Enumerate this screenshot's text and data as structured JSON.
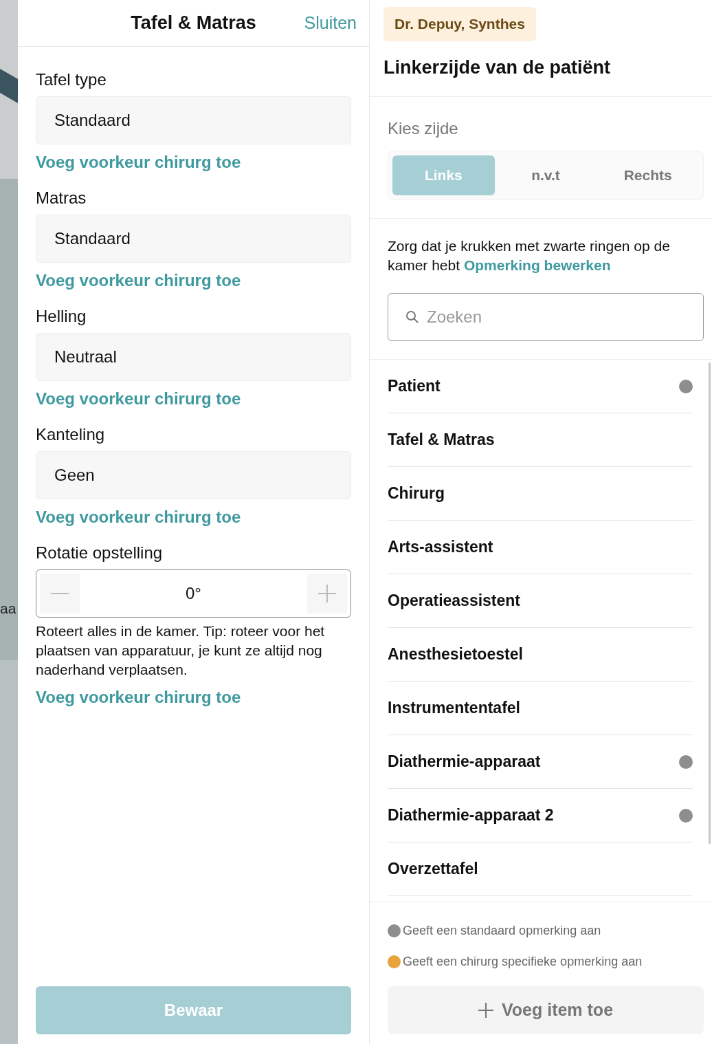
{
  "backdrop": {
    "text": "aa"
  },
  "panel": {
    "title": "Tafel & Matras",
    "close": "Sluiten",
    "fields": [
      {
        "kind": "select",
        "label": "Tafel type",
        "value": "Standaard",
        "link": "Voeg voorkeur chirurg toe"
      },
      {
        "kind": "select",
        "label": "Matras",
        "value": "Standaard",
        "link": "Voeg voorkeur chirurg toe"
      },
      {
        "kind": "select",
        "label": "Helling",
        "value": "Neutraal",
        "link": "Voeg voorkeur chirurg toe"
      },
      {
        "kind": "select",
        "label": "Kanteling",
        "value": "Geen",
        "link": "Voeg voorkeur chirurg toe"
      },
      {
        "kind": "stepper",
        "label": "Rotatie opstelling",
        "value": "0°",
        "help": "Roteert alles in de kamer. Tip: roteer voor het plaatsen van apparatuur, je kunt ze altijd nog naderhand verplaatsen.",
        "link": "Voeg voorkeur chirurg toe"
      }
    ],
    "save": "Bewaar"
  },
  "detail": {
    "surgeon_tag": "Dr. Depuy, Synthes",
    "title": "Linkerzijde van de patiënt",
    "side_label": "Kies zijde",
    "sides": [
      {
        "label": "Links",
        "selected": true
      },
      {
        "label": "n.v.t",
        "selected": false
      },
      {
        "label": "Rechts",
        "selected": false
      }
    ],
    "note": "Zorg dat je krukken met zwarte ringen op de kamer hebt",
    "note_link": "Opmerking bewerken",
    "search": {
      "placeholder": "Zoeken"
    },
    "items": [
      {
        "name": "Patient",
        "color": "#8e8e8e"
      },
      {
        "name": "Tafel & Matras"
      },
      {
        "name": "Chirurg"
      },
      {
        "name": "Arts-assistent"
      },
      {
        "name": "Operatieassistent"
      },
      {
        "name": "Anesthesietoestel"
      },
      {
        "name": "Instrumententafel"
      },
      {
        "name": "Diathermie-apparaat",
        "color": "#8e8e8e"
      },
      {
        "name": "Diathermie-apparaat 2",
        "color": "#8e8e8e"
      },
      {
        "name": "Overzettafel"
      }
    ],
    "legend": [
      {
        "color": "#8e8e8e",
        "text": "Geeft een standaard opmerking aan"
      },
      {
        "color": "#e8a33d",
        "text": "Geeft een chirurg specifieke opmerking aan"
      }
    ],
    "add": "Voeg item toe"
  }
}
